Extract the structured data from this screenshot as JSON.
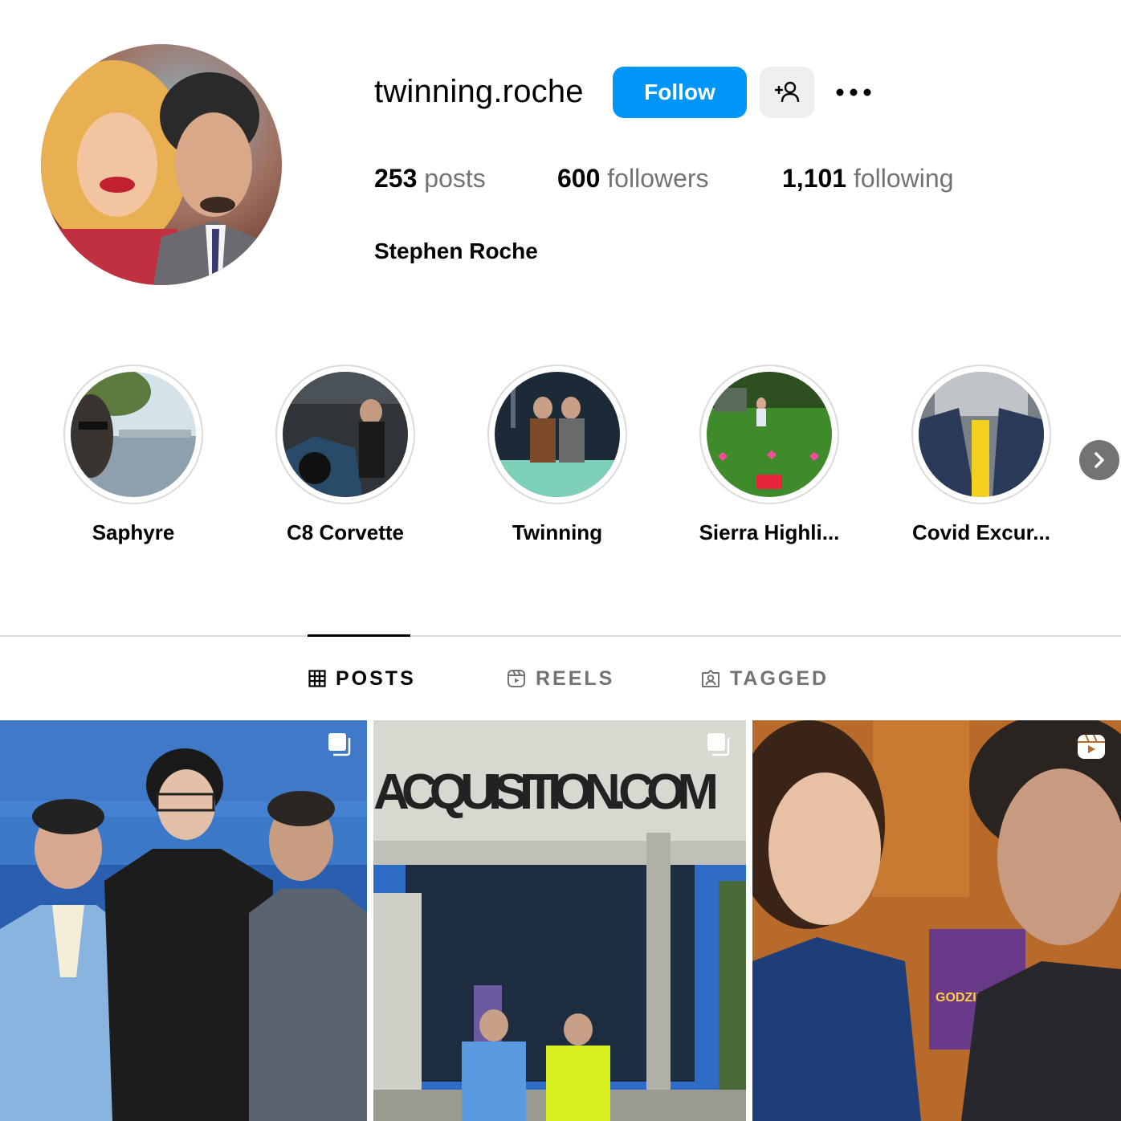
{
  "profile": {
    "username": "twinning.roche",
    "full_name": "Stephen Roche",
    "follow_label": "Follow",
    "stats": {
      "posts_count": "253",
      "posts_label": "posts",
      "followers_count": "600",
      "followers_label": "followers",
      "following_count": "1,101",
      "following_label": "following"
    }
  },
  "highlights": [
    {
      "label": "Saphyre"
    },
    {
      "label": "C8 Corvette"
    },
    {
      "label": "Twinning"
    },
    {
      "label": "Sierra Highli..."
    },
    {
      "label": "Covid Excur..."
    }
  ],
  "tabs": [
    {
      "label": "POSTS",
      "active": true
    },
    {
      "label": "REELS",
      "active": false
    },
    {
      "label": "TAGGED",
      "active": false
    }
  ],
  "posts": [
    {
      "type": "carousel"
    },
    {
      "type": "carousel",
      "sign_text": "ACQUISITION.COM"
    },
    {
      "type": "reel",
      "box_text": "GODZILLA x KONG"
    }
  ],
  "colors": {
    "accent": "#0095f6",
    "secondary_text": "#737373",
    "divider": "#dbdbdb"
  }
}
